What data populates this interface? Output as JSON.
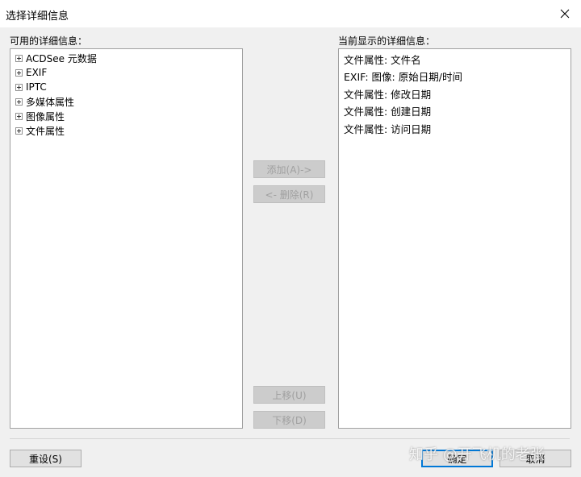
{
  "window": {
    "title": "选择详细信息",
    "close_icon": "close-icon"
  },
  "available": {
    "label": "可用的详细信息：",
    "items": [
      {
        "label": "ACDSee 元数据"
      },
      {
        "label": "EXIF"
      },
      {
        "label": "IPTC"
      },
      {
        "label": "多媒体属性"
      },
      {
        "label": "图像属性"
      },
      {
        "label": "文件属性"
      }
    ]
  },
  "current": {
    "label": "当前显示的详细信息：",
    "items": [
      "文件属性: 文件名",
      "EXIF: 图像: 原始日期/时间",
      "文件属性: 修改日期",
      "文件属性: 创建日期",
      "文件属性: 访问日期"
    ]
  },
  "buttons": {
    "add": "添加(A)->",
    "remove": "<- 删除(R)",
    "move_up": "上移(U)",
    "move_down": "下移(D)",
    "reset": "重设(S)",
    "ok": "确定",
    "cancel": "取消"
  },
  "watermark": "知乎 @开飞机的老张",
  "colors": {
    "background": "#f0f0f0",
    "accent": "#0078d7"
  }
}
